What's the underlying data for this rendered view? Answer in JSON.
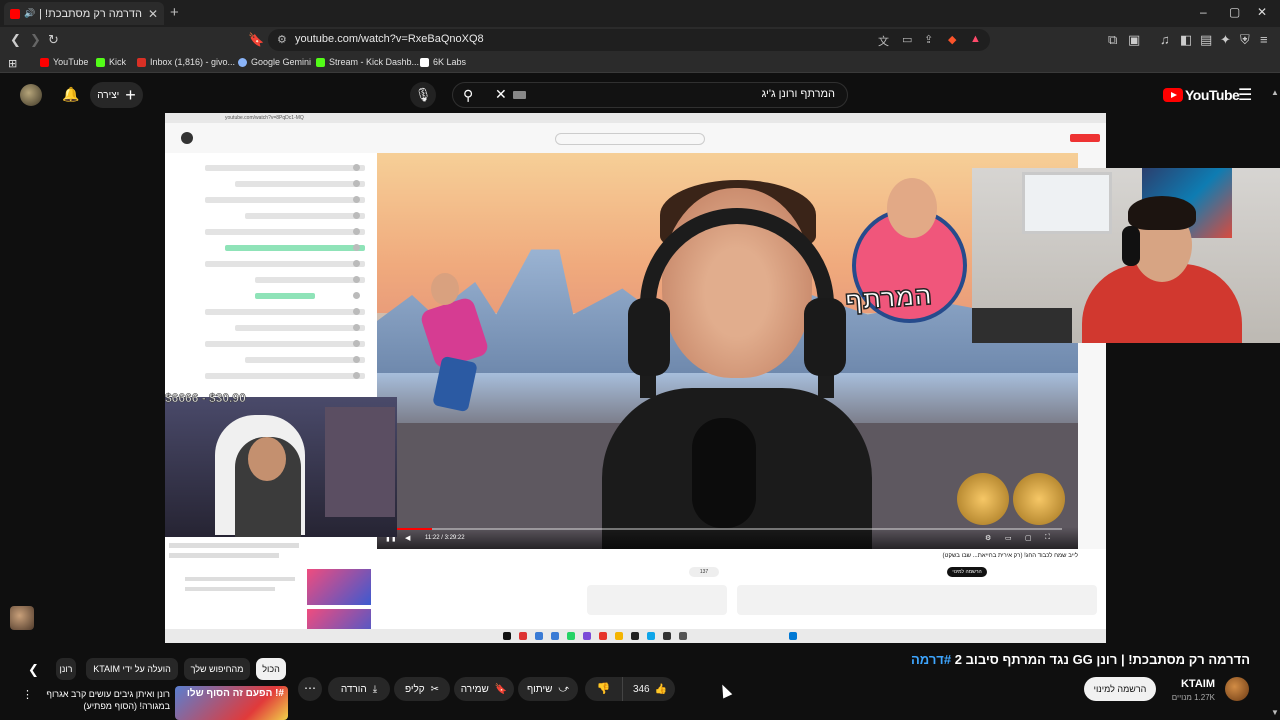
{
  "browser": {
    "tab_title": "הדרמה רק מסתבכת! | רונן GG",
    "new_tab_icon": "+",
    "url": "youtube.com/watch?v=RxeBaQnoXQ8",
    "window_controls": [
      "–",
      "▢",
      "✕"
    ],
    "bookmarks": [
      {
        "label": "YouTube",
        "color": "#ff0000"
      },
      {
        "label": "Kick",
        "color": "#53fc18"
      },
      {
        "label": "Inbox (1,816) - givo...",
        "color": "#d93025"
      },
      {
        "label": "Google Gemini",
        "color": "#8ab4f8"
      },
      {
        "label": "Stream - Kick Dashb...",
        "color": "#53fc18"
      },
      {
        "label": "6K Labs",
        "color": "#ffffff"
      }
    ]
  },
  "masthead": {
    "logo_word": "YouTube",
    "search_query": "המרתף ורונן ג'יג",
    "create_label": "יצירה",
    "create_plus": "+"
  },
  "video": {
    "inner_url": "youtube.com/watch?v=8PqDc1-MQ",
    "time": "11:22 / 3:29:22",
    "progress_fraction": 0.052,
    "donation": "$6666 - $30.90",
    "logo_art_text": "המרתף",
    "inner_title": "לייב שמח לכבוד החג! (רק אירית בחייאת... שבו בשקט)",
    "inner_subscribe": "הרשמה למינוי",
    "inner_like_count": "137"
  },
  "meta": {
    "title": "הדרמה רק מסתבכת! | רונן GG נגד המרתף סיבוב 2",
    "hashtag": "#דרמה",
    "channel_name": "KTAIM",
    "channel_subs": "1.27K מנויים",
    "subscribe_label": "הרשמה למינוי",
    "like_count": "346",
    "share_label": "שיתוף",
    "save_label": "שמירה",
    "clip_label": "קליפ",
    "download_label": "הורדה",
    "more_label": "⋯"
  },
  "chips": [
    {
      "label": "הכול",
      "active": true
    },
    {
      "label": "מהחיפוש שלך",
      "active": false
    },
    {
      "label": "הועלה על ידי KTAIM",
      "active": false
    },
    {
      "label": "רונן",
      "active": false
    }
  ],
  "recommendation": {
    "thumb_text": "#! הפעם זה הסוף שלו",
    "title": "רונן ואיתן גיבים עושים קרב אגרוף במגורה! (הסוף מפתיע)"
  }
}
